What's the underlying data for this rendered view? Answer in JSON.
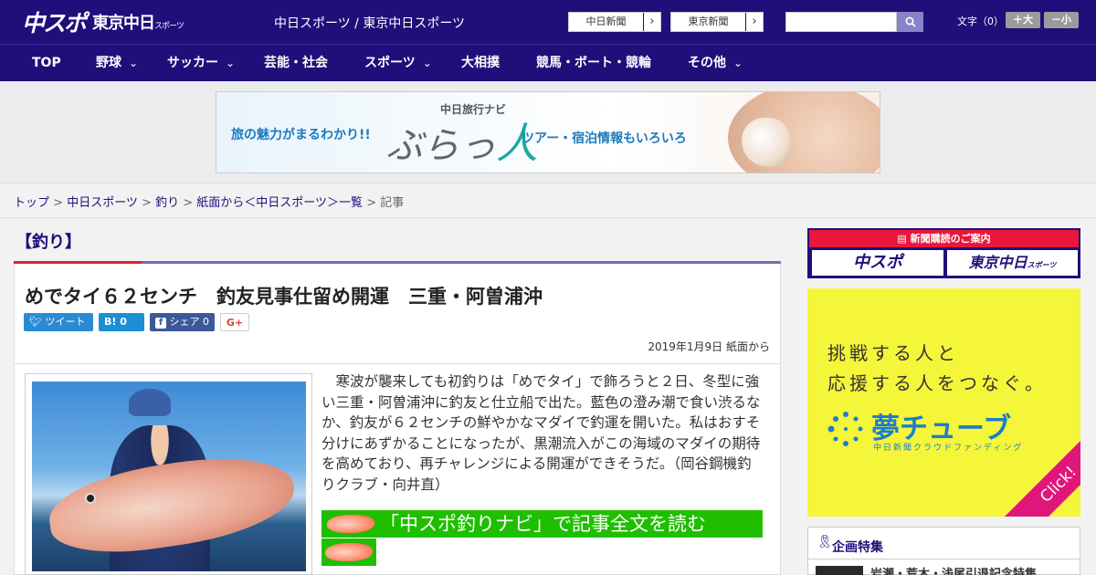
{
  "header": {
    "logo_chuspo": "中スポ",
    "logo_tokyo": "東京中日",
    "logo_tokyo_small": "スポーツ",
    "site_title": "中日スポーツ / 東京中日スポーツ",
    "buttons": [
      {
        "label": "中日新聞"
      },
      {
        "label": "東京新聞"
      }
    ],
    "search_placeholder": "",
    "font_size_label": "文字（0）",
    "font_plus": "＋大",
    "font_minus": "－小"
  },
  "nav": {
    "items": [
      {
        "label": "TOP",
        "dropdown": false
      },
      {
        "label": "野球",
        "dropdown": true
      },
      {
        "label": "サッカー",
        "dropdown": true
      },
      {
        "label": "芸能・社会",
        "dropdown": false
      },
      {
        "label": "スポーツ",
        "dropdown": true
      },
      {
        "label": "大相撲",
        "dropdown": false
      },
      {
        "label": "競馬・ボート・競輪",
        "dropdown": false
      },
      {
        "label": "その他",
        "dropdown": true
      }
    ]
  },
  "banner": {
    "left": "旅の魅力がまるわかり!!",
    "small": "中日旅行ナビ",
    "big": "ぶらっ",
    "big_teal": "人",
    "right": "ツアー・宿泊情報もいろいろ"
  },
  "breadcrumb": {
    "items": [
      "トップ",
      "中日スポーツ",
      "釣り",
      "紙面から＜中日スポーツ＞一覧"
    ],
    "current": "記事"
  },
  "article": {
    "category": "【釣り】",
    "title": "めでタイ６２センチ　釣友見事仕留め開運　三重・阿曽浦沖",
    "share": {
      "tweet": "ツイート",
      "hatena": "B!",
      "hatena_count": "0",
      "facebook": "シェア",
      "facebook_count": "0",
      "gplus": "G+"
    },
    "date": "2019年1月9日 紙面から",
    "body": "寒波が襲来しても初釣りは「めでタイ」で飾ろうと２日、冬型に強い三重・阿曽浦沖に釣友と仕立船で出た。藍色の澄み潮で食い渋るなか、釣友が６２センチの鮮やかなマダイで釣運を開いた。私はおすそ分けにあずかることになったが、黒潮流入がこの海域のマダイの期待を高めており、再チャレンジによる開運ができそうだ。（岡谷鋼機釣りクラブ・向井直）",
    "read_more": "「中スポ釣りナビ」で記事全文を読む"
  },
  "sidebar": {
    "subscribe_title": "新聞購読のご案内",
    "subscribe_chuspo": "中スポ",
    "subscribe_tokyo": "東京中日",
    "subscribe_tokyo_small": "スポーツ",
    "ad_line1": "挑戦する人と",
    "ad_line2": "応援する人をつなぐ。",
    "ad_logo": "夢チューブ",
    "ad_sub": "中日新聞クラウドファンディング",
    "ad_click": "Click!",
    "feature_title": "企画特集",
    "feature_item": "岩瀬・荒木・浅尾引退記念特集"
  },
  "colors": {
    "brand_navy": "#1e0f7a",
    "accent_red": "#d9232d",
    "read_more_green": "#1fbf00",
    "ad_yellow": "#f5f53a"
  }
}
